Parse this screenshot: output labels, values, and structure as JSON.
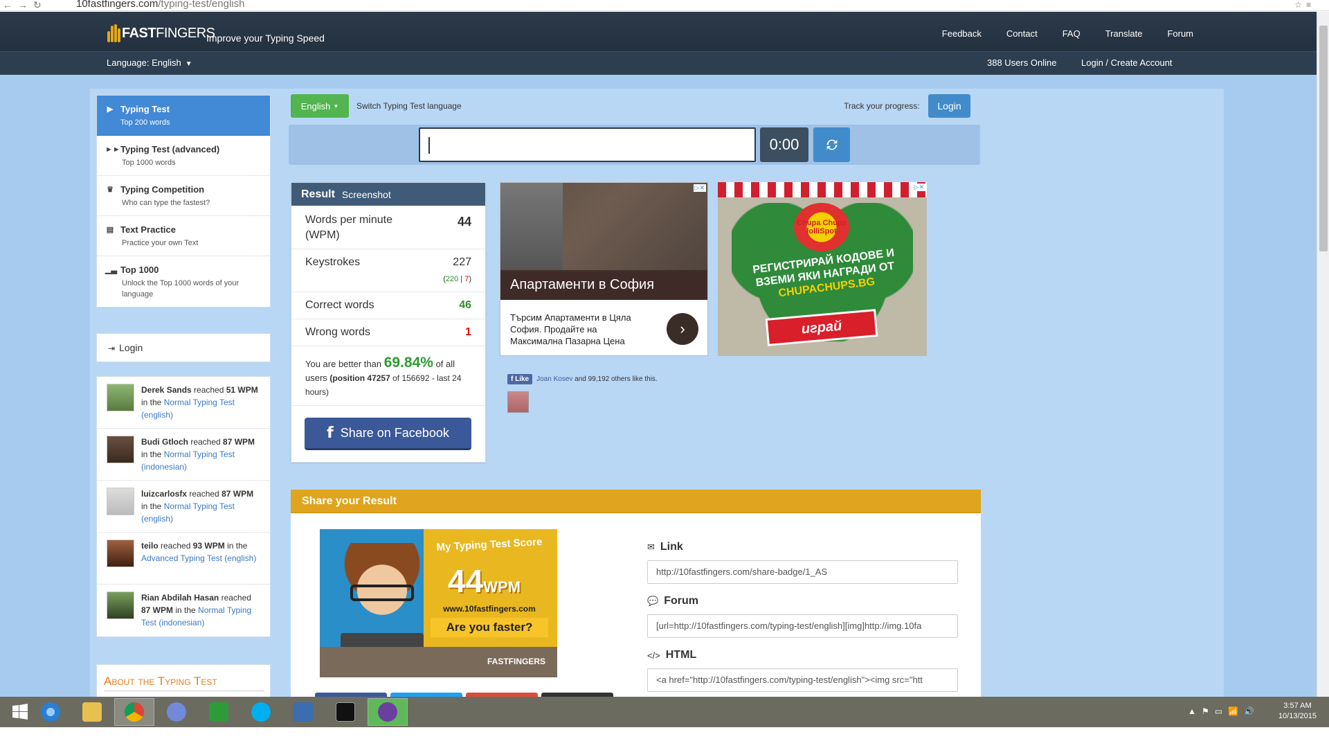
{
  "browser": {
    "url_host": "10fastfingers.com",
    "url_path": "/typing-test/english"
  },
  "header": {
    "logo_prefix": "10",
    "logo_fast": "FAST",
    "logo_fingers": "FINGERS",
    "tagline": "Improve your Typing Speed",
    "nav": [
      "Feedback",
      "Contact",
      "FAQ",
      "Translate",
      "Forum"
    ],
    "language": "Language: English",
    "users_online": "388 Users Online",
    "login": "Login / Create Account"
  },
  "sidebar": {
    "items": [
      {
        "title": "Typing Test",
        "subtitle": "Top 200 words",
        "icon": "play-icon",
        "glyph": "▶",
        "active": true
      },
      {
        "title": "Typing Test (advanced)",
        "subtitle": "Top 1000 words",
        "icon": "fast-forward-icon",
        "glyph": "⏩",
        "active": false
      },
      {
        "title": "Typing Competition",
        "subtitle": "Who can type the fastest?",
        "icon": "trophy-icon",
        "glyph": "🏆",
        "active": false
      },
      {
        "title": "Text Practice",
        "subtitle": "Practice your own Text",
        "icon": "document-icon",
        "glyph": "▤",
        "active": false
      },
      {
        "title": "Top 1000",
        "subtitle": "Unlock the Top 1000 words of your language",
        "icon": "bar-chart-icon",
        "glyph": "▁▃▅",
        "active": false
      }
    ],
    "login_label": "Login",
    "feed": [
      {
        "name": "Derek Sands",
        "pre": " reached ",
        "wpm": "51 WPM",
        "mid": " in the ",
        "link": "Normal Typing Test (english)"
      },
      {
        "name": "Budi Gtloch",
        "pre": " reached ",
        "wpm": "87 WPM",
        "mid": " in the ",
        "link": "Normal Typing Test (indonesian)"
      },
      {
        "name": "luizcarlosfx",
        "pre": " reached ",
        "wpm": "87 WPM",
        "mid": " in the ",
        "link": "Normal Typing Test (english)"
      },
      {
        "name": "teilo",
        "pre": " reached ",
        "wpm": "93 WPM",
        "mid": " in the ",
        "link": "Advanced Typing Test (english)"
      },
      {
        "name": "Rian Abdilah Hasan",
        "pre": " reached ",
        "wpm": "87 WPM",
        "mid": " in the ",
        "link": "Normal Typing Test (indonesian)"
      }
    ],
    "about_title": "About the Typing Test"
  },
  "test": {
    "language_button": "English",
    "switch_text": "Switch Typing Test language",
    "track_text": "Track your progress:",
    "login_button": "Login",
    "input_value": "",
    "timer": "0:00"
  },
  "result": {
    "title": "Result",
    "screenshot": "Screenshot",
    "wpm_label": "Words per minute (WPM)",
    "wpm_value": "44",
    "keystrokes_label": "Keystrokes",
    "keystrokes_value": "227",
    "keystrokes_correct": "220",
    "keystrokes_sep": " | ",
    "keystrokes_wrong": "7",
    "correct_label": "Correct words",
    "correct_value": "46",
    "wrong_label": "Wrong words",
    "wrong_value": "1",
    "better_pre": "You are better than ",
    "better_pct": "69.84%",
    "better_post": " of all users",
    "position": "(position 47257",
    "position_rest": " of 156692 - last 24 hours)",
    "share_fb": "Share on Facebook"
  },
  "ads": {
    "ad1_title": "Апартаменти в София",
    "ad1_desc": "Търсим Апартаменти в Цяла София. Продайте на Максимална Пазарна Цена",
    "ad2_brand": "Chupa Chups lolliSpot",
    "ad2_text_a": "РЕГИСТРИРАЙ КОДОВЕ И ВЗЕМИ ЯКИ НАГРАДИ ОТ ",
    "ad2_text_b": "CHUPACHUPS.BG",
    "ad2_button": "играй",
    "adchoices": "▷✕"
  },
  "like": {
    "button": "Like",
    "name": "Joan Kosev",
    "rest": " and 99,192 others like this."
  },
  "share": {
    "title": "Share your Result",
    "badge_title": "My Typing Test Score",
    "badge_score": "44",
    "badge_unit": "WPM",
    "badge_url": "www.10fastfingers.com",
    "badge_question": "Are you faster?",
    "badge_logo": "FASTFINGERS",
    "link_label": "Link",
    "link_value": "http://10fastfingers.com/share-badge/1_AS",
    "forum_label": "Forum",
    "forum_value": "[url=http://10fastfingers.com/typing-test/english][img]http://img.10fa",
    "html_label": "HTML",
    "html_value": "<a href=\"http://10fastfingers.com/typing-test/english\"><img src=\"htt"
  },
  "taskbar": {
    "time": "3:57 AM",
    "date": "10/13/2015"
  },
  "colors": {
    "accent_blue": "#428bca",
    "green": "#52b550",
    "header": "#2c3a4a",
    "share_orange": "#e0a41e"
  }
}
